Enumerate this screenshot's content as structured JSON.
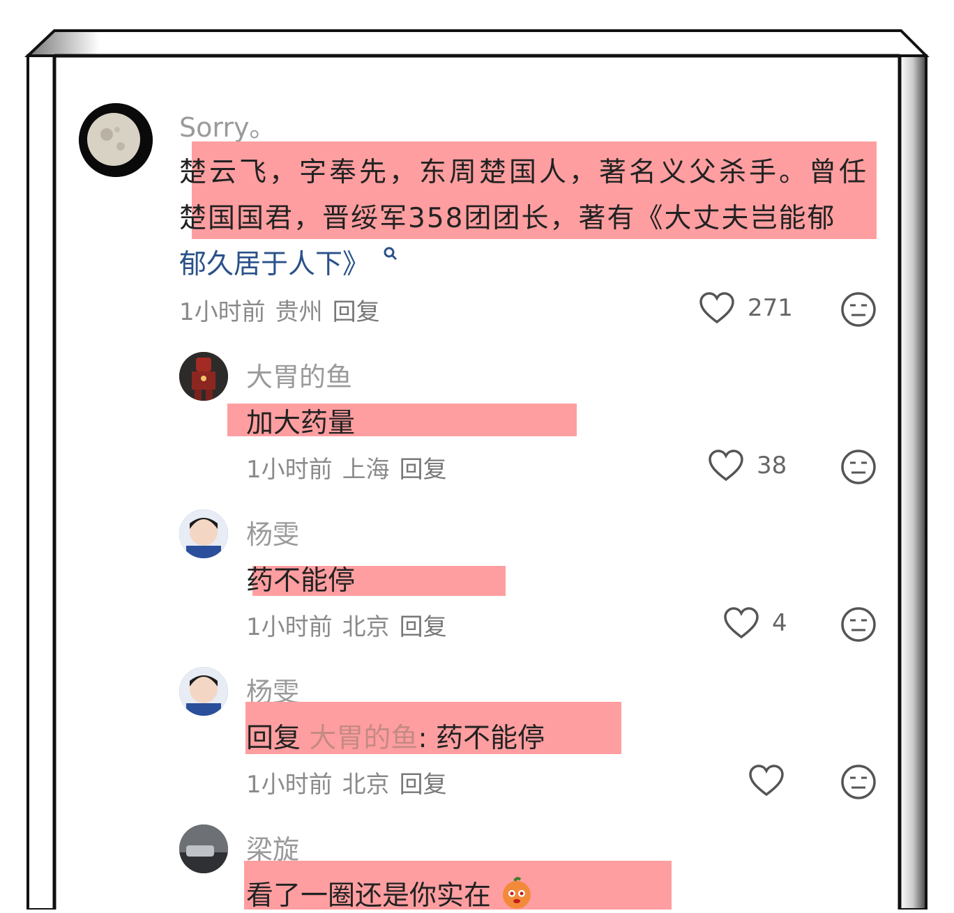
{
  "comments": [
    {
      "name": "Sorry。",
      "text_line1": "楚云飞，字奉先，东周楚国人，著名义父杀手。曾任",
      "text_line2": "楚国国君，晋绥军358团团长，著有《大丈夫岂能郁",
      "text_line3": "郁久居于人下》",
      "time": "1小时前",
      "location": "贵州",
      "reply": "回复",
      "likes": "271"
    },
    {
      "name": "大胃的鱼",
      "text": "加大药量",
      "time": "1小时前",
      "location": "上海",
      "reply": "回复",
      "likes": "38"
    },
    {
      "name": "杨雯",
      "text": "药不能停",
      "time": "1小时前",
      "location": "北京",
      "reply": "回复",
      "likes": "4"
    },
    {
      "name": "杨雯",
      "text_prefix": "回复",
      "text_ref": "大胃的鱼",
      "text_rest": ": 药不能停",
      "time": "1小时前",
      "location": "北京",
      "reply": "回复",
      "likes": ""
    },
    {
      "name": "梁旋",
      "text": "看了一圈还是你实在"
    }
  ],
  "icons": {
    "like": "heart-outline-icon",
    "dislike": "meh-face-icon",
    "search": "search-icon",
    "emoji": "orange-emoji-icon"
  },
  "colors": {
    "highlight": "#ff9ea0",
    "link": "#2a5189"
  }
}
